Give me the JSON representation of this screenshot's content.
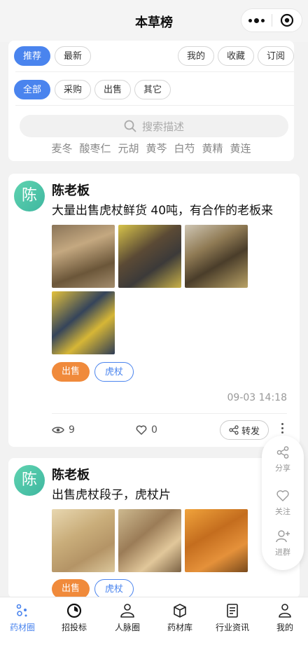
{
  "header": {
    "title": "本草榜"
  },
  "filters": {
    "sort_tabs": [
      "推荐",
      "最新"
    ],
    "right_tabs": [
      "我的",
      "收藏",
      "订阅"
    ],
    "types": [
      "全部",
      "采购",
      "出售",
      "其它"
    ],
    "search_placeholder": "搜索描述",
    "herbs": [
      "麦冬",
      "酸枣仁",
      "元胡",
      "黄芩",
      "白芍",
      "黄精",
      "黄连"
    ]
  },
  "posts": [
    {
      "avatar_char": "陈",
      "author": "陈老板",
      "content": "大量出售虎杖鲜货 40吨，有合作的老板来",
      "tags": [
        "出售",
        "虎杖"
      ],
      "time": "09-03 14:18",
      "views": "9",
      "likes": "0",
      "share_label": "转发"
    },
    {
      "avatar_char": "陈",
      "author": "陈老板",
      "content": "出售虎杖段子，虎杖片",
      "tags": [
        "出售",
        "虎杖"
      ]
    }
  ],
  "float_actions": [
    "分享",
    "关注",
    "进群"
  ],
  "tabbar": [
    "药材圈",
    "招投标",
    "人脉圈",
    "药材库",
    "行业资讯",
    "我的"
  ],
  "colors": {
    "accent": "#4a84ee",
    "orange": "#f08a3b",
    "avatar": "#4fc7a8"
  }
}
